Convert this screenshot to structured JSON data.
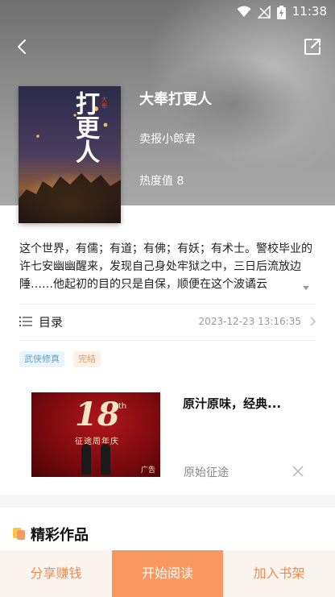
{
  "status_bar": {
    "time": "11:38"
  },
  "header": {
    "back_icon": "chevron-left-icon",
    "share_icon": "share-export-icon"
  },
  "book": {
    "title": "大奉打更人",
    "author": "卖报小郎君",
    "heat": "热度值 8",
    "cover_title": "打更人",
    "cover_small": "大奉",
    "description": "这个世界，有儒；有道；有佛；有妖；有术士。警校毕业的许七安幽幽醒来，发现自己身处牢狱之中，三日后流放边陲……他起初的目的只是自保，顺便在这个波谲云"
  },
  "toc": {
    "label": "目录",
    "updated": "2023-12-23 13:16:35"
  },
  "tags": [
    {
      "label": "武侠修真",
      "color": "#5da2cf"
    },
    {
      "label": "完结",
      "color": "#ef9a58"
    }
  ],
  "ad": {
    "title": "原汁原味，经典...",
    "source": "原始征途",
    "image_big": "18",
    "image_sup": "th",
    "image_sub": "征途周年庆",
    "image_badge": "广告"
  },
  "section": {
    "title": "精彩作品"
  },
  "bottom_bar": {
    "share_label": "分享赚钱",
    "read_label": "开始阅读",
    "shelf_label": "加入书架",
    "accent": "#f89760"
  }
}
